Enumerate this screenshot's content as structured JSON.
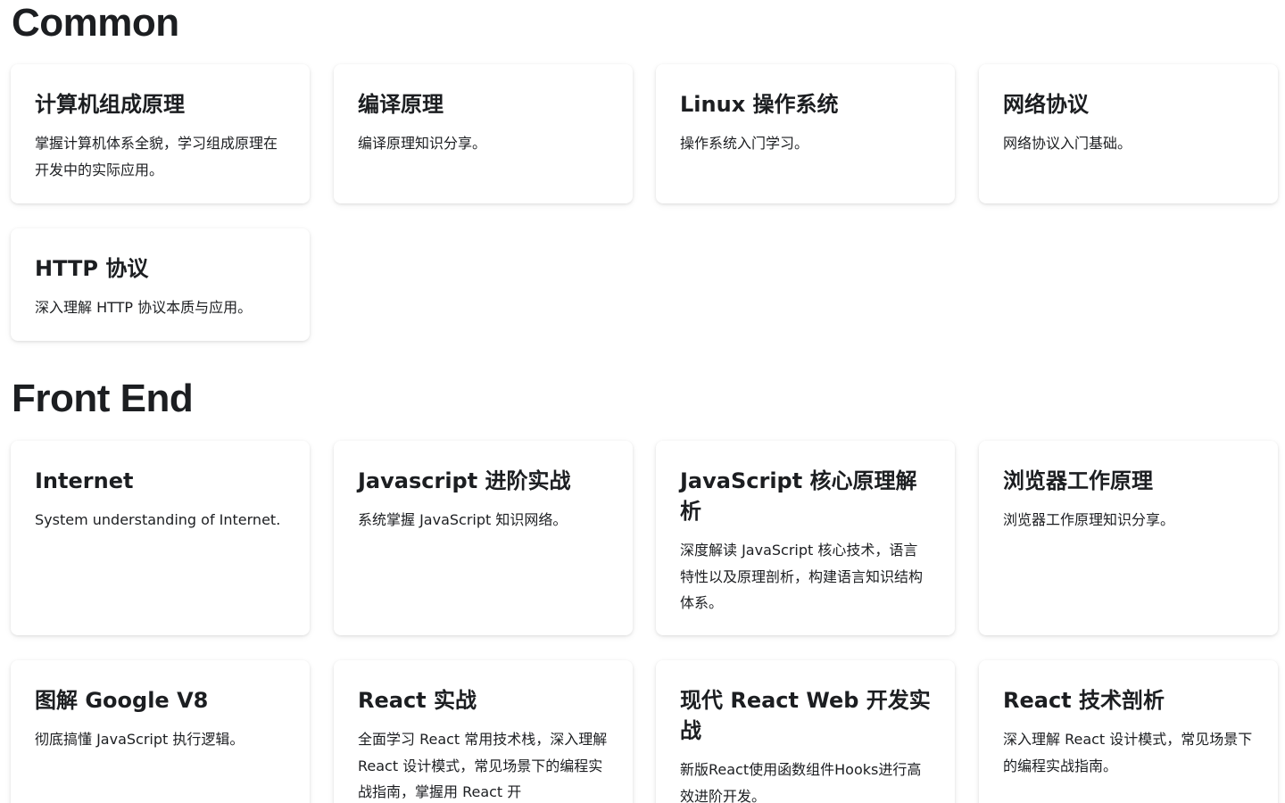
{
  "sections": [
    {
      "title": "Common",
      "cards": [
        {
          "title": "计算机组成原理",
          "desc": "掌握计算机体系全貌，学习组成原理在开发中的实际应用。"
        },
        {
          "title": "编译原理",
          "desc": "编译原理知识分享。"
        },
        {
          "title": "Linux 操作系统",
          "desc": "操作系统入门学习。"
        },
        {
          "title": "网络协议",
          "desc": "网络协议入门基础。"
        },
        {
          "title": "HTTP 协议",
          "desc": "深入理解 HTTP 协议本质与应用。"
        }
      ]
    },
    {
      "title": "Front End",
      "cards": [
        {
          "title": "Internet",
          "desc": "System understanding of Internet."
        },
        {
          "title": "Javascript 进阶实战",
          "desc": "系统掌握 JavaScript 知识网络。"
        },
        {
          "title": "JavaScript 核心原理解析",
          "desc": "深度解读 JavaScript 核心技术，语言特性以及原理剖析，构建语言知识结构体系。"
        },
        {
          "title": "浏览器工作原理",
          "desc": "浏览器工作原理知识分享。"
        },
        {
          "title": "图解 Google V8",
          "desc": "彻底搞懂 JavaScript 执行逻辑。"
        },
        {
          "title": "React 实战",
          "desc": "全面学习 React 常用技术栈，深入理解 React 设计模式，常见场景下的编程实战指南，掌握用 React 开"
        },
        {
          "title": "现代 React Web 开发实战",
          "desc": "新版React使用函数组件Hooks进行高效进阶开发。"
        },
        {
          "title": "React 技术剖析",
          "desc": "深入理解 React 设计模式，常见场景下的编程实战指南。"
        }
      ]
    }
  ]
}
